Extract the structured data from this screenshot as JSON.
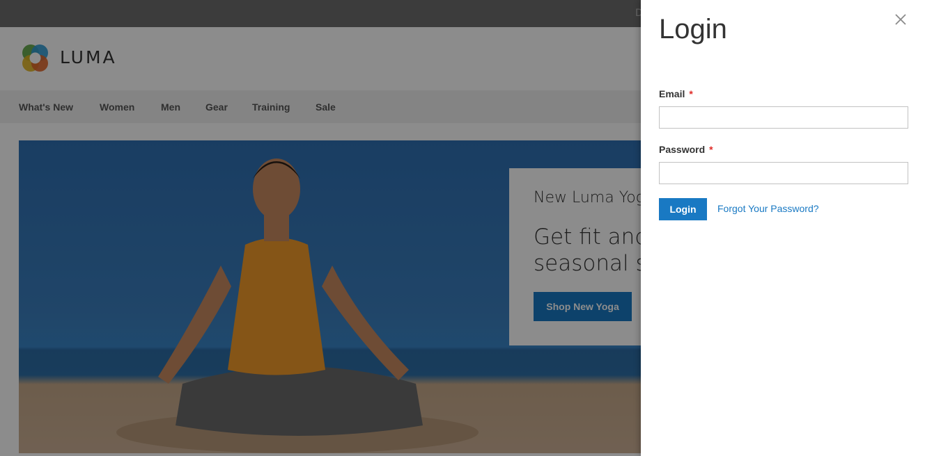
{
  "topbar": {
    "text": "D"
  },
  "header": {
    "logo_text": "LUMA"
  },
  "nav": {
    "items": [
      "What's New",
      "Women",
      "Men",
      "Gear",
      "Training",
      "Sale"
    ]
  },
  "hero": {
    "subtitle": "New Luma Yoga",
    "title": "Get fit and seasonal st",
    "button_label": "Shop New Yoga"
  },
  "modal": {
    "title": "Login",
    "email_label": "Email",
    "email_value": "",
    "password_label": "Password",
    "password_value": "",
    "required_marker": "*",
    "login_button": "Login",
    "forgot_link": "Forgot Your Password?"
  },
  "colors": {
    "accent": "#1979c3",
    "required": "#e02b27"
  }
}
